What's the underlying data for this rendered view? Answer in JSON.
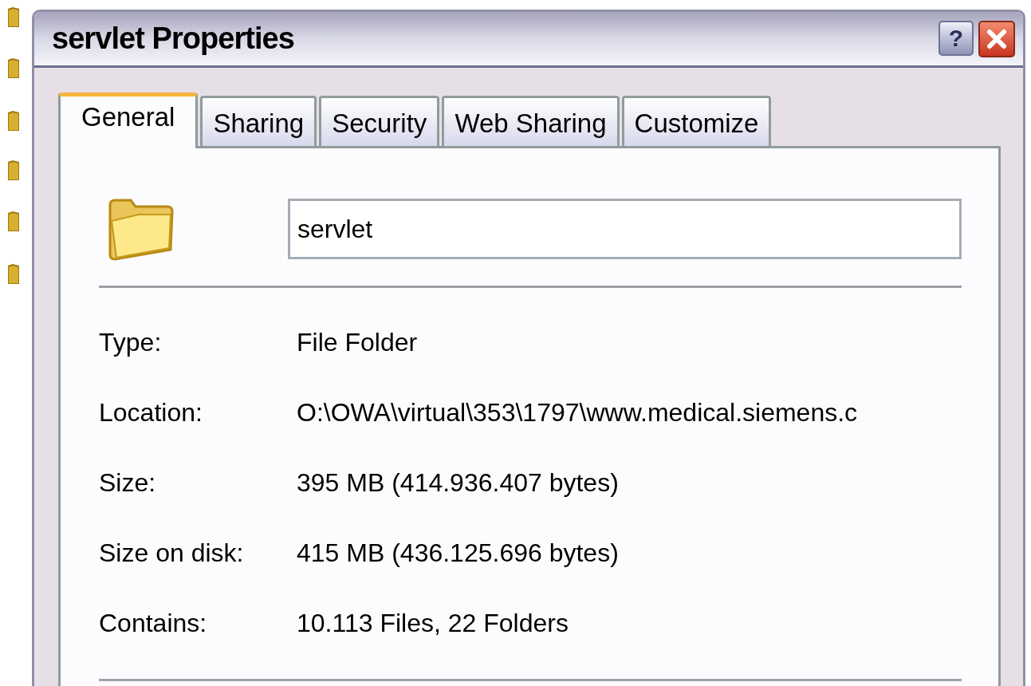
{
  "window": {
    "title": "servlet Properties",
    "buttons": [
      {
        "kind": "help",
        "label": "?"
      },
      {
        "kind": "close"
      }
    ]
  },
  "tabs": [
    {
      "label": "General",
      "selected": true
    },
    {
      "label": "Sharing",
      "selected": false
    },
    {
      "label": "Security",
      "selected": false
    },
    {
      "label": "Web Sharing",
      "selected": false
    },
    {
      "label": "Customize",
      "selected": false
    }
  ],
  "name_field": {
    "value": "servlet"
  },
  "properties": [
    {
      "label": "Type:",
      "value": "File Folder"
    },
    {
      "label": "Location:",
      "value": "O:\\OWA\\virtual\\353\\1797\\www.medical.siemens.c"
    },
    {
      "label": "Size:",
      "value": "395 MB (414.936.407 bytes)"
    },
    {
      "label": "Size on disk:",
      "value": "415 MB (436.125.696 bytes)"
    },
    {
      "label": "Contains:",
      "value": "10.113 Files, 22 Folders"
    }
  ]
}
